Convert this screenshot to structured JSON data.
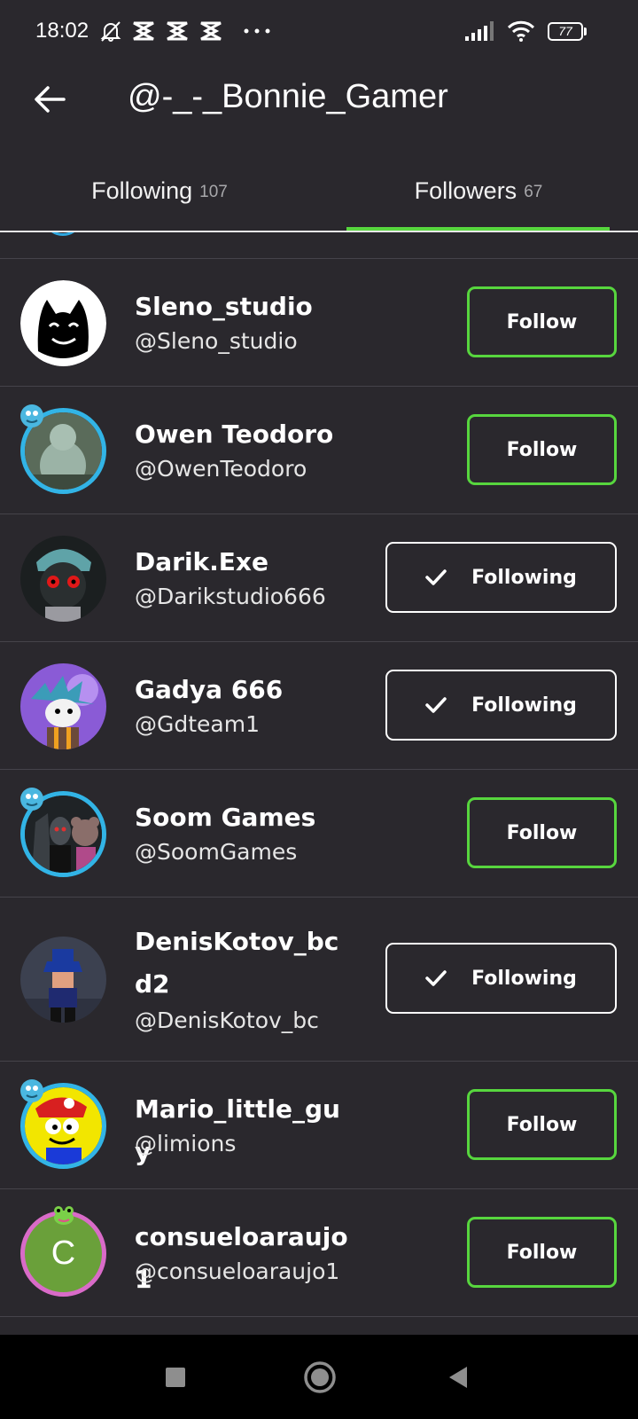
{
  "status_bar": {
    "time": "18:02",
    "battery": "77",
    "icons": [
      "muted-bell-icon",
      "app-notification-icon",
      "app-notification-icon",
      "app-notification-icon",
      "more-dots-icon",
      "signal-icon",
      "wifi-icon",
      "battery-icon"
    ]
  },
  "header": {
    "title": "@-_-_Bonnie_Gamer"
  },
  "tabs": [
    {
      "label": "Following",
      "count": "107",
      "active": false
    },
    {
      "label": "Followers",
      "count": "67",
      "active": true
    }
  ],
  "accent_color": "#57d63e",
  "users": [
    {
      "name": "Sleno_studio",
      "handle": "@Sleno_studio",
      "button": "Follow",
      "following": false
    },
    {
      "name": "Owen Teodoro",
      "handle": "@OwenTeodoro",
      "button": "Follow",
      "following": false
    },
    {
      "name": "Darik.Exe",
      "handle": "@Darikstudio666",
      "button": "Following",
      "following": true
    },
    {
      "name": "Gadya 666",
      "handle": "@Gdteam1",
      "button": "Following",
      "following": true
    },
    {
      "name": "Soom Games",
      "handle": "@SoomGames",
      "button": "Follow",
      "following": false
    },
    {
      "name": "DenisKotov_bcd2",
      "handle": "@DenisKotov_bc",
      "button": "Following",
      "following": true
    },
    {
      "name": "Mario_little_guy",
      "handle": "@limions",
      "button": "Follow",
      "following": false
    },
    {
      "name": "consueloaraujo1",
      "handle": "@consueloaraujo1",
      "button": "Follow",
      "following": false,
      "avatar_letter": "C"
    }
  ]
}
